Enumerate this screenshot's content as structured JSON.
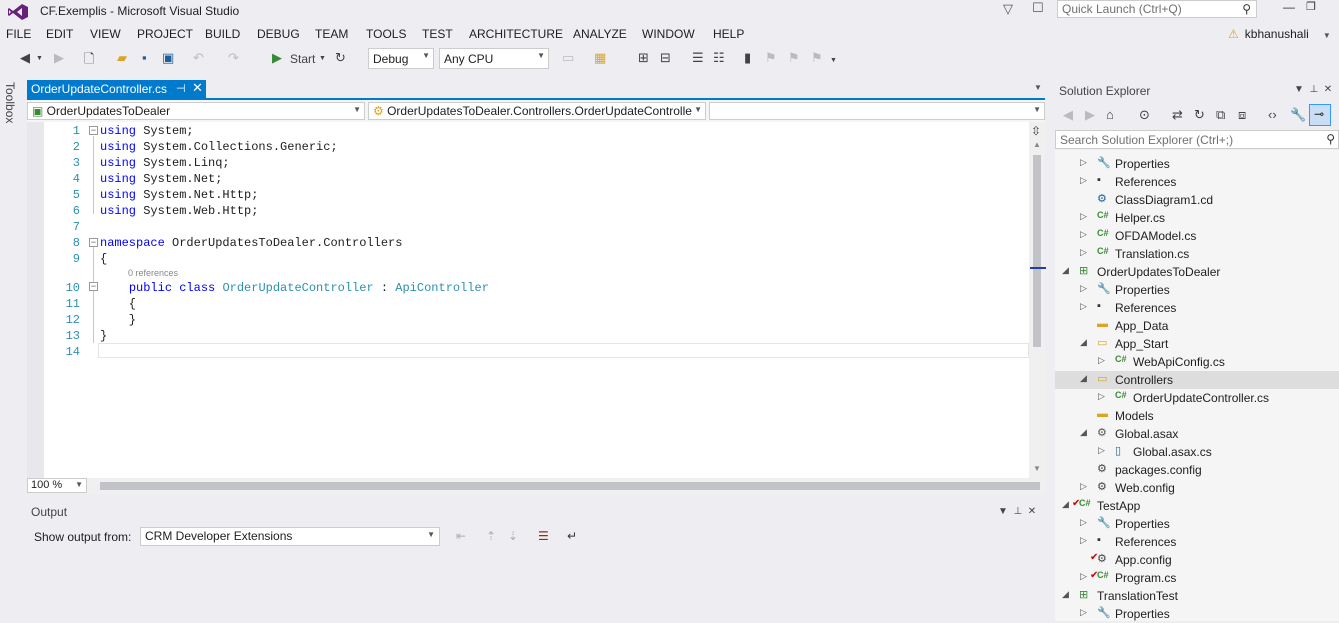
{
  "window": {
    "title": "CF.Exemplis - Microsoft Visual Studio",
    "quick_launch_placeholder": "Quick Launch (Ctrl+Q)",
    "user": "kbhanushali"
  },
  "menu": [
    "FILE",
    "EDIT",
    "VIEW",
    "PROJECT",
    "BUILD",
    "DEBUG",
    "TEAM",
    "TOOLS",
    "TEST",
    "ARCHITECTURE",
    "ANALYZE",
    "WINDOW",
    "HELP"
  ],
  "toolbar": {
    "start_label": "Start",
    "config": "Debug",
    "platform": "Any CPU"
  },
  "toolbox_label": "Toolbox",
  "editor": {
    "tab": "OrderUpdateController.cs",
    "nav_project": "OrderUpdatesToDealer",
    "nav_class": "OrderUpdatesToDealer.Controllers.OrderUpdateControlle",
    "zoom": "100 %",
    "references_hint": "0 references",
    "lines": [
      {
        "n": "1",
        "kw": "using",
        "rest": " System;"
      },
      {
        "n": "2",
        "kw": "using",
        "rest": " System.Collections.Generic;"
      },
      {
        "n": "3",
        "kw": "using",
        "rest": " System.Linq;"
      },
      {
        "n": "4",
        "kw": "using",
        "rest": " System.Net;"
      },
      {
        "n": "5",
        "kw": "using",
        "rest": " System.Net.Http;"
      },
      {
        "n": "6",
        "kw": "using",
        "rest": " System.Web.Http;"
      },
      {
        "n": "7",
        "kw": "",
        "rest": ""
      },
      {
        "n": "8",
        "kw": "namespace",
        "rest": " OrderUpdatesToDealer.Controllers"
      },
      {
        "n": "9",
        "kw": "",
        "rest": "{"
      },
      {
        "n": "10",
        "kw": "public class",
        "rest": " ",
        "type": "OrderUpdateController",
        "mid": " : ",
        "base": "ApiController",
        "indent": "    "
      },
      {
        "n": "11",
        "kw": "",
        "rest": "    {"
      },
      {
        "n": "12",
        "kw": "",
        "rest": "    }"
      },
      {
        "n": "13",
        "kw": "",
        "rest": "}"
      },
      {
        "n": "14",
        "kw": "",
        "rest": ""
      }
    ]
  },
  "output": {
    "title": "Output",
    "show_from_label": "Show output from:",
    "source": "CRM Developer Extensions"
  },
  "solution_explorer": {
    "title": "Solution Explorer",
    "search_placeholder": "Search Solution Explorer (Ctrl+;)",
    "nodes": [
      {
        "label": "Properties",
        "depth": 1,
        "tw": "▷",
        "icon": "wrench",
        "sel": false
      },
      {
        "label": "References",
        "depth": 1,
        "tw": "▷",
        "icon": "refs",
        "sel": false
      },
      {
        "label": "ClassDiagram1.cd",
        "depth": 1,
        "tw": "",
        "icon": "diagram",
        "sel": false
      },
      {
        "label": "Helper.cs",
        "depth": 1,
        "tw": "▷",
        "icon": "cs",
        "sel": false
      },
      {
        "label": "OFDAModel.cs",
        "depth": 1,
        "tw": "▷",
        "icon": "cs",
        "sel": false
      },
      {
        "label": "Translation.cs",
        "depth": 1,
        "tw": "▷",
        "icon": "cs",
        "sel": false
      },
      {
        "label": "OrderUpdatesToDealer",
        "depth": 0,
        "tw": "◢",
        "icon": "webproj",
        "sel": false
      },
      {
        "label": "Properties",
        "depth": 1,
        "tw": "▷",
        "icon": "wrench",
        "sel": false
      },
      {
        "label": "References",
        "depth": 1,
        "tw": "▷",
        "icon": "refs",
        "sel": false
      },
      {
        "label": "App_Data",
        "depth": 1,
        "tw": "",
        "icon": "folder",
        "sel": false
      },
      {
        "label": "App_Start",
        "depth": 1,
        "tw": "◢",
        "icon": "folder-open",
        "sel": false
      },
      {
        "label": "WebApiConfig.cs",
        "depth": 2,
        "tw": "▷",
        "icon": "cs",
        "sel": false
      },
      {
        "label": "Controllers",
        "depth": 1,
        "tw": "◢",
        "icon": "folder-open",
        "sel": true
      },
      {
        "label": "OrderUpdateController.cs",
        "depth": 2,
        "tw": "▷",
        "icon": "cs",
        "sel": false
      },
      {
        "label": "Models",
        "depth": 1,
        "tw": "",
        "icon": "folder",
        "sel": false
      },
      {
        "label": "Global.asax",
        "depth": 1,
        "tw": "◢",
        "icon": "gear",
        "sel": false
      },
      {
        "label": "Global.asax.cs",
        "depth": 2,
        "tw": "▷",
        "icon": "file",
        "sel": false
      },
      {
        "label": "packages.config",
        "depth": 1,
        "tw": "",
        "icon": "config",
        "sel": false
      },
      {
        "label": "Web.config",
        "depth": 1,
        "tw": "▷",
        "icon": "config",
        "sel": false
      },
      {
        "label": "TestApp",
        "depth": 0,
        "tw": "◢",
        "icon": "csproj",
        "sel": false
      },
      {
        "label": "Properties",
        "depth": 1,
        "tw": "▷",
        "icon": "wrench",
        "sel": false
      },
      {
        "label": "References",
        "depth": 1,
        "tw": "▷",
        "icon": "refs",
        "sel": false
      },
      {
        "label": "App.config",
        "depth": 1,
        "tw": "",
        "icon": "config-check",
        "sel": false
      },
      {
        "label": "Program.cs",
        "depth": 1,
        "tw": "▷",
        "icon": "cs-check",
        "sel": false
      },
      {
        "label": "TranslationTest",
        "depth": 0,
        "tw": "◢",
        "icon": "webproj",
        "sel": false
      },
      {
        "label": "Properties",
        "depth": 1,
        "tw": "▷",
        "icon": "wrench",
        "sel": false
      }
    ]
  },
  "colors": {
    "accent": "#007acc",
    "keyword": "#0000ff",
    "type": "#2b91af",
    "line_number": "#2b91af",
    "chrome": "#eeeef2"
  }
}
